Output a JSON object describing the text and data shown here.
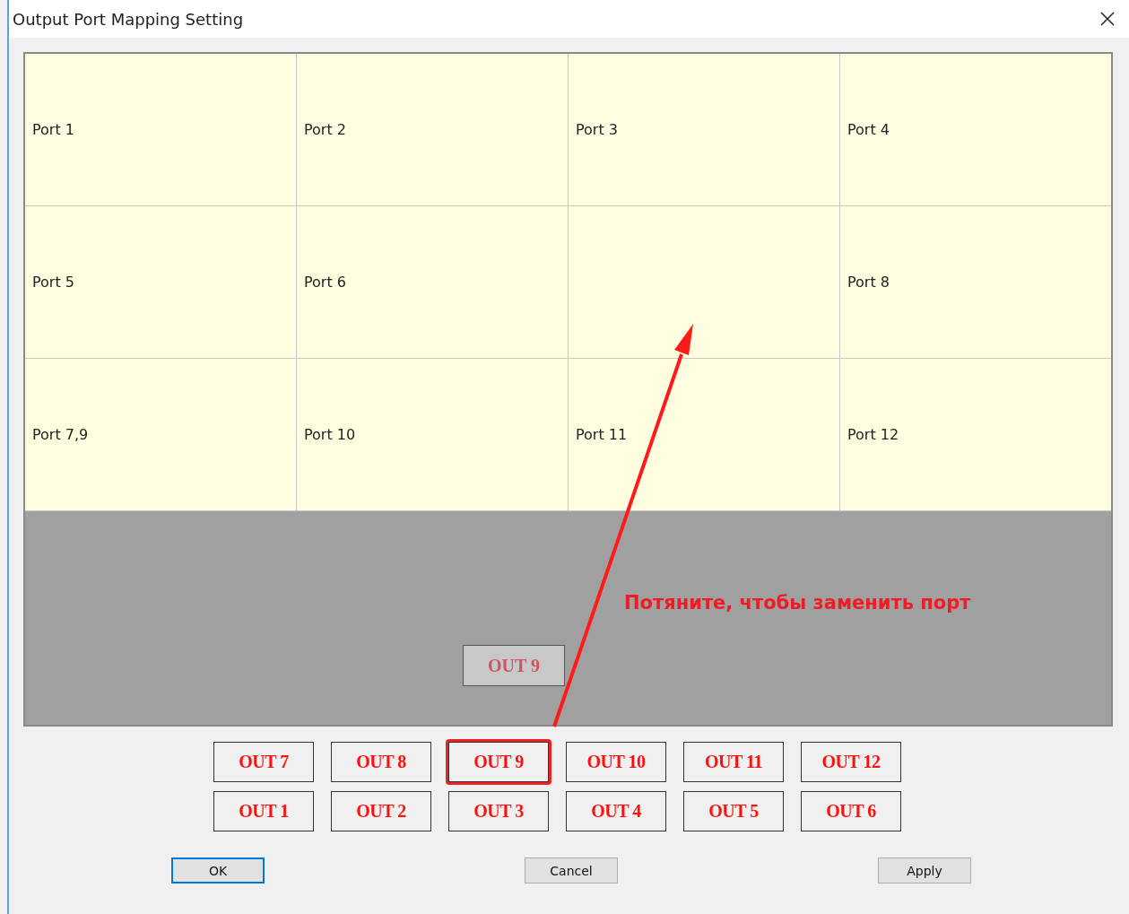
{
  "window": {
    "title": "Output Port Mapping Setting"
  },
  "grid": {
    "cells": [
      {
        "kind": "port",
        "label": "Port 1"
      },
      {
        "kind": "port",
        "label": "Port 2"
      },
      {
        "kind": "port",
        "label": "Port 3"
      },
      {
        "kind": "port",
        "label": "Port 4"
      },
      {
        "kind": "port",
        "label": "Port 5"
      },
      {
        "kind": "port",
        "label": "Port 6"
      },
      {
        "kind": "empty"
      },
      {
        "kind": "port",
        "label": "Port 8"
      },
      {
        "kind": "port",
        "label": "Port 7,9"
      },
      {
        "kind": "port",
        "label": "Port 10"
      },
      {
        "kind": "port",
        "label": "Port 11"
      },
      {
        "kind": "port",
        "label": "Port 12"
      }
    ]
  },
  "dragged_output": {
    "label": "OUT 9"
  },
  "annotation": {
    "text": "Потяните, чтобы заменить порт"
  },
  "outputs": [
    {
      "label": "OUT 7",
      "highlighted": false
    },
    {
      "label": "OUT 8",
      "highlighted": false
    },
    {
      "label": "OUT 9",
      "highlighted": true
    },
    {
      "label": "OUT 10",
      "highlighted": false
    },
    {
      "label": "OUT 11",
      "highlighted": false
    },
    {
      "label": "OUT 12",
      "highlighted": false
    },
    {
      "label": "OUT 1",
      "highlighted": false
    },
    {
      "label": "OUT 2",
      "highlighted": false
    },
    {
      "label": "OUT 3",
      "highlighted": false
    },
    {
      "label": "OUT 4",
      "highlighted": false
    },
    {
      "label": "OUT 5",
      "highlighted": false
    },
    {
      "label": "OUT 6",
      "highlighted": false
    }
  ],
  "buttons": [
    {
      "label": "OK",
      "focused": true
    },
    {
      "label": "Cancel",
      "focused": false
    },
    {
      "label": "Apply",
      "focused": false
    }
  ]
}
